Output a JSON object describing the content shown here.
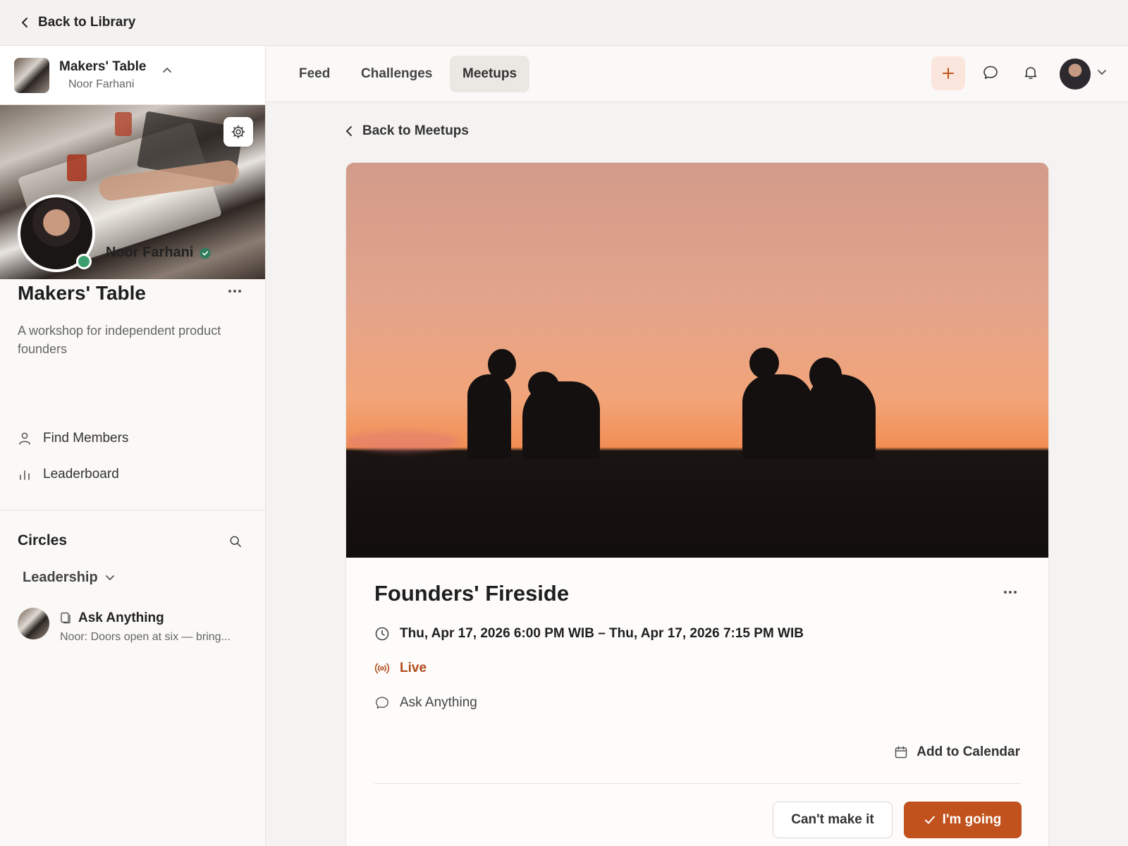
{
  "topbar": {
    "back_label": "Back to Library"
  },
  "community": {
    "name": "Makers' Table",
    "owner": "Noor Farhani",
    "title": "Makers' Table",
    "description": "A workshop for independent product founders",
    "host_name": "Noor Farhani"
  },
  "sidebar": {
    "links": [
      {
        "label": "Find Members",
        "icon": "person-icon"
      },
      {
        "label": "Leaderboard",
        "icon": "bar-chart-icon"
      }
    ],
    "circles_title": "Circles",
    "group_label": "Leadership",
    "thread": {
      "title": "Ask Anything",
      "preview": "Noor: Doors open at six — bring..."
    }
  },
  "nav": {
    "tabs": [
      {
        "label": "Feed",
        "active": false
      },
      {
        "label": "Challenges",
        "active": false
      },
      {
        "label": "Meetups",
        "active": true
      }
    ]
  },
  "event": {
    "back_label": "Back to Meetups",
    "title": "Founders' Fireside",
    "time": "Thu, Apr 17, 2026 6:00 PM WIB – Thu, Apr 17, 2026 7:15 PM WIB",
    "status": "Live",
    "circle": "Ask Anything",
    "add_calendar": "Add to Calendar",
    "cant_label": "Can't make it",
    "going_label": "I'm going"
  },
  "colors": {
    "accent": "#c2521d",
    "live": "#b24c1c",
    "online": "#3c9e6c",
    "verified": "#2e7d5b"
  }
}
